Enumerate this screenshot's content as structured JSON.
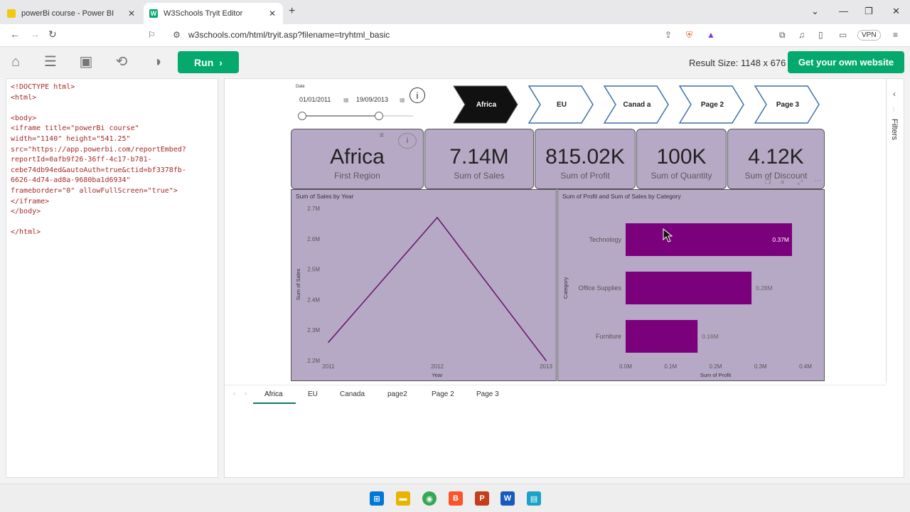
{
  "browser": {
    "tabs": [
      {
        "label": "powerBi course - Power BI"
      },
      {
        "label": "W3Schools Tryit Editor"
      }
    ],
    "url": "w3schools.com/html/tryit.asp?filename=tryhtml_basic",
    "vpn": "VPN"
  },
  "editor": {
    "run_label": "Run",
    "result_size": "Result Size: 1148 x 676",
    "get_website": "Get your own website",
    "code": "<!DOCTYPE html>\n<html>\n\n<body>\n<iframe title=\"powerBi course\"\nwidth=\"1140\" height=\"541.25\"\nsrc=\"https://app.powerbi.com/reportEmbed?\nreportId=0afb9f26-36ff-4c17-b781-\ncebe74db94ed&autoAuth=true&ctid=bf3378fb-\n6626-4d74-ad8a-9680ba1d6934\"\nframeborder=\"0\" allowFullScreen=\"true\">\n</iframe>\n</body>\n\n</html>"
  },
  "report": {
    "date_label": "Date",
    "date_start": "01/01/2011",
    "date_end": "19/09/2013",
    "nav_buttons": [
      "Africa",
      "EU",
      "Canad a",
      "Page 2",
      "Page 3"
    ],
    "cards": [
      {
        "value": "Africa",
        "label": "First Region"
      },
      {
        "value": "7.14M",
        "label": "Sum of Sales"
      },
      {
        "value": "815.02K",
        "label": "Sum of Profit"
      },
      {
        "value": "100K",
        "label": "Sum of Quantity"
      },
      {
        "value": "4.12K",
        "label": "Sum of Discount"
      }
    ],
    "page_tabs": [
      "Africa",
      "EU",
      "Canada",
      "page2",
      "Page 2",
      "Page 3"
    ],
    "filters_label": "Filters"
  },
  "chart_data": [
    {
      "type": "line",
      "title": "Sum of Sales by Year",
      "xlabel": "Year",
      "ylabel": "Sum of Sales",
      "x": [
        "2011",
        "2012",
        "2013"
      ],
      "series": [
        {
          "values": [
            2.26,
            2.67,
            2.2
          ]
        }
      ],
      "ylim": [
        2.2,
        2.7
      ],
      "yticks": [
        "2.2M",
        "2.3M",
        "2.4M",
        "2.5M",
        "2.6M",
        "2.7M"
      ],
      "color": "#6b1a6b"
    },
    {
      "type": "bar",
      "orientation": "horizontal",
      "title": "Sum of Profit and Sum of Sales by Category",
      "xlabel": "Sum of Profit",
      "ylabel": "Category",
      "categories": [
        "Technology",
        "Office Supplies",
        "Furniture"
      ],
      "values": [
        0.37,
        0.28,
        0.16
      ],
      "data_labels": [
        "0.37M",
        "0.28M",
        "0.16M"
      ],
      "xlim": [
        0,
        0.4
      ],
      "xticks": [
        "0.0M",
        "0.1M",
        "0.2M",
        "0.3M",
        "0.4M"
      ],
      "color": "#7b007b"
    }
  ],
  "taskbar": {
    "apps": [
      "windows-start",
      "file-explorer",
      "chrome",
      "brave",
      "powerpoint",
      "word",
      "notepad"
    ]
  }
}
